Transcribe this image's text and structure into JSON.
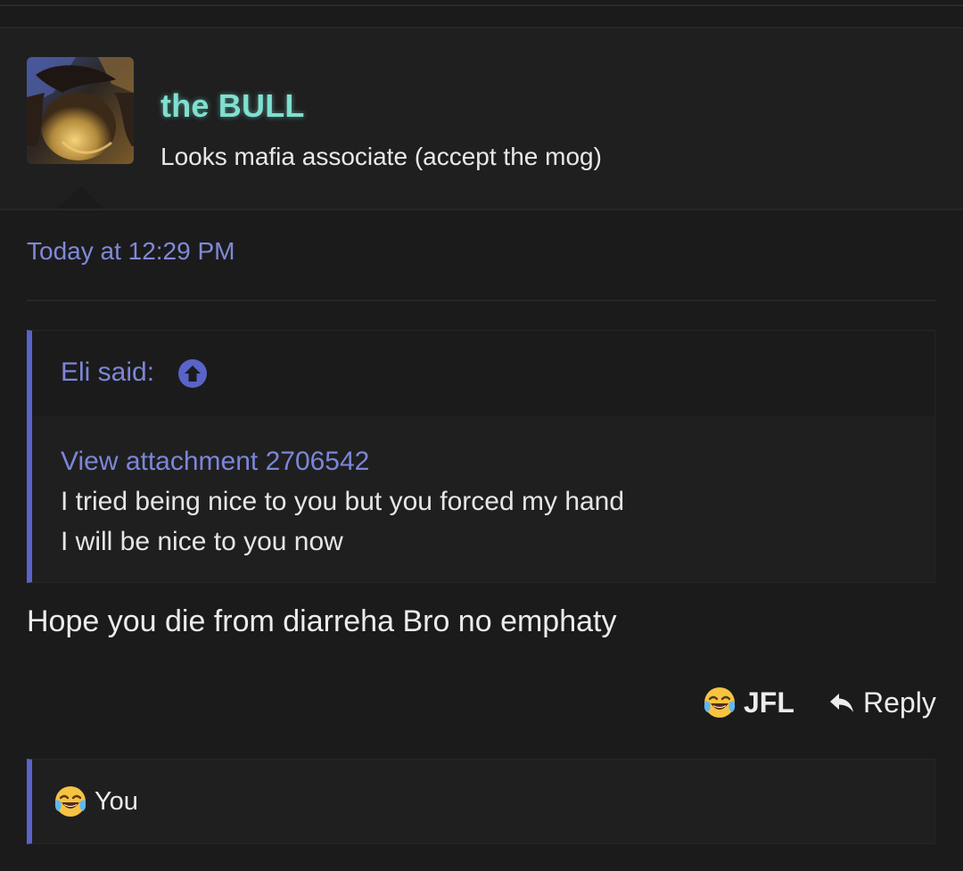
{
  "post": {
    "author": {
      "name": "the BULL",
      "title": "Looks mafia associate (accept the mog)",
      "name_color": "#7fe0cf"
    },
    "date": "Today at 12:29 PM",
    "quote": {
      "author_label": "Eli said:",
      "jump_icon": "arrow-up-circle-icon",
      "attachment_link": "View attachment 2706542",
      "lines": [
        "I tried being nice to you but you forced my hand",
        "I will be nice to you now"
      ]
    },
    "message": "Hope you die from diarreha Bro no emphaty",
    "actions": {
      "reaction_icon": "tears-of-joy-emoji",
      "reaction_label": "JFL",
      "reply_icon": "reply-arrow-icon",
      "reply_label": "Reply"
    },
    "reactions_bar": {
      "icon": "tears-of-joy-emoji",
      "users": "You"
    }
  },
  "colors": {
    "accent": "#5a63c8",
    "link": "#7c86d8",
    "background": "#1b1b1c"
  }
}
